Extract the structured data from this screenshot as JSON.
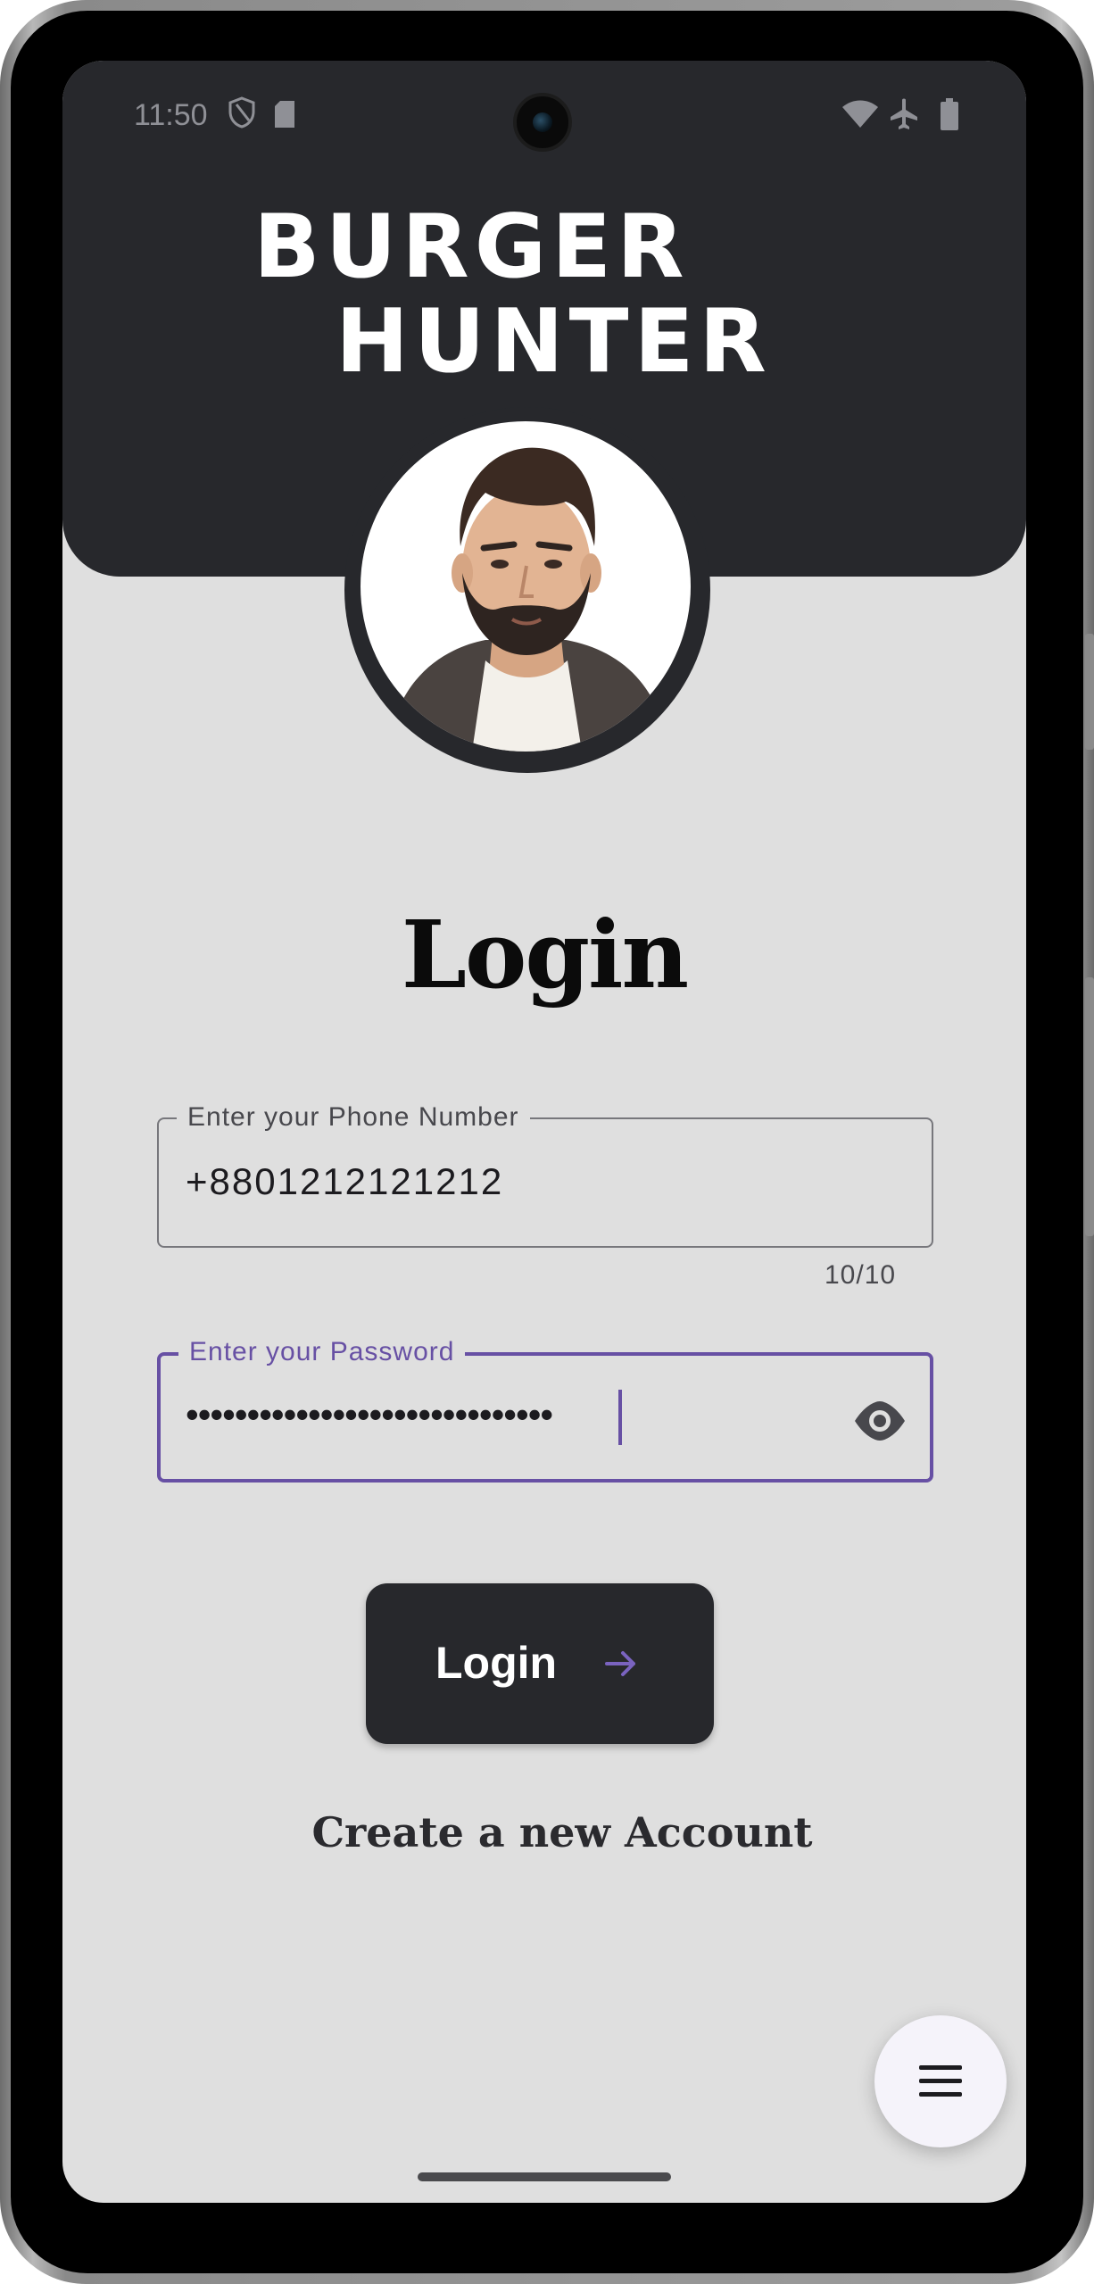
{
  "status_bar": {
    "time": "11:50",
    "icons": [
      "shield-icon",
      "sd-card-icon",
      "wifi-icon",
      "airplane-icon",
      "battery-icon"
    ]
  },
  "brand": {
    "line1": "BURGER",
    "line2": "HUNTER"
  },
  "avatar": {
    "icon": "user-avatar-illustration"
  },
  "page_title": "Login",
  "phone_field": {
    "label": "Enter your Phone Number",
    "value": "+8801212121212",
    "counter": "10/10"
  },
  "password_field": {
    "label": "Enter your Password",
    "masked_value": "••••••••••••••••••••••••••••••",
    "toggle_icon": "eye-icon"
  },
  "login_button": {
    "label": "Login",
    "icon": "arrow-right-icon"
  },
  "create_account_link": "Create a new Account",
  "fab": {
    "icon": "menu-icon"
  },
  "colors": {
    "header_bg": "#27282c",
    "screen_bg": "#dfdfdf",
    "accent": "#6750a4",
    "fab_bg": "#f5f3fa"
  }
}
